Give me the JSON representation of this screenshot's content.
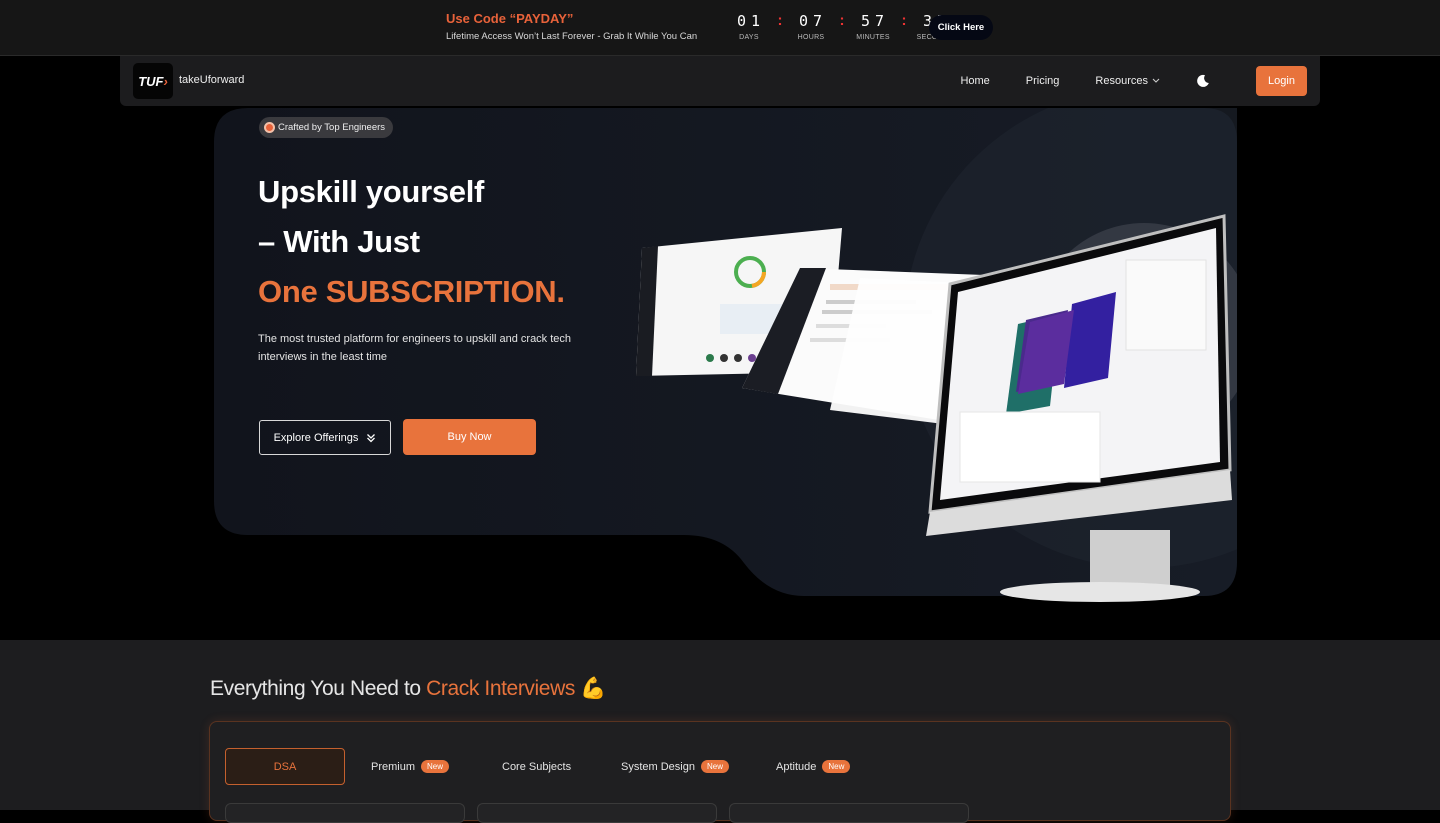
{
  "promo": {
    "code_text": "Use Code “PAYDAY”",
    "subtitle": "Lifetime Access Won’t Last Forever - Grab It While You Can",
    "countdown": [
      {
        "digits": "01",
        "label": "DAYS"
      },
      {
        "digits": "07",
        "label": "HOURS"
      },
      {
        "digits": "57",
        "label": "MINUTES"
      },
      {
        "digits": "37",
        "label": "SECONDS"
      }
    ],
    "cta_label": "Click Here"
  },
  "nav": {
    "logo_text": "TUF",
    "brand": "takeUforward",
    "links": [
      "Home",
      "Pricing",
      "Resources"
    ],
    "login_label": "Login",
    "theme_icon": "moon-icon"
  },
  "hero": {
    "badge": "Crafted by Top Engineers",
    "line1": "Upskill yourself",
    "line2": "– With Just",
    "line3": "One SUBSCRIPTION.",
    "description": "The most trusted platform for engineers to upskill and crack tech interviews in the least time",
    "explore_label": "Explore Offerings",
    "buy_label": "Buy Now"
  },
  "section": {
    "title_prefix": "Everything You Need to ",
    "title_accent": "Crack Interviews",
    "title_emoji": "💪",
    "tabs": [
      {
        "label": "DSA",
        "is_new": false
      },
      {
        "label": "Premium",
        "is_new": true
      },
      {
        "label": "Core Subjects",
        "is_new": false
      },
      {
        "label": "System Design",
        "is_new": true
      },
      {
        "label": "Aptitude",
        "is_new": true
      }
    ],
    "new_label": "New"
  },
  "colors": {
    "accent": "#e8733c",
    "background": "#000000",
    "panel": "#1d1d1f"
  }
}
